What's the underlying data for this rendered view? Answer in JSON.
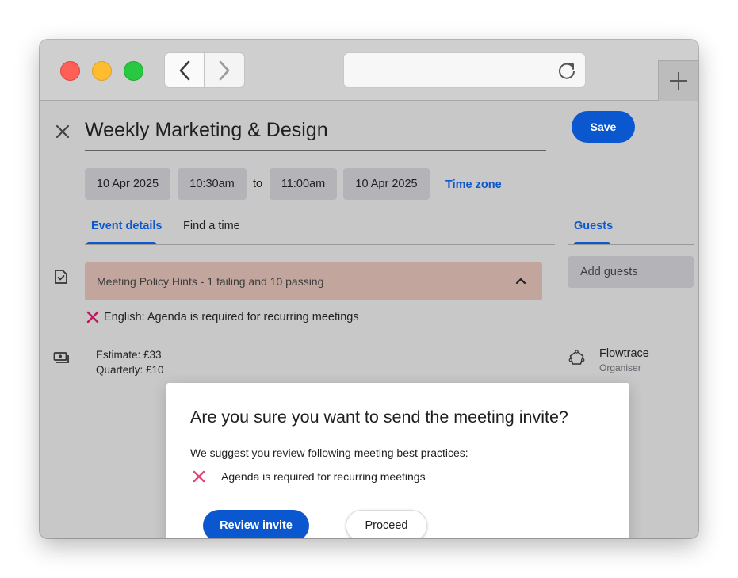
{
  "browser": {
    "back_icon": "chevron-left-icon",
    "forward_icon": "chevron-right-icon",
    "reload_icon": "reload-icon",
    "new_tab_icon": "plus-icon",
    "url": ""
  },
  "event": {
    "title": "Weekly Marketing & Design",
    "save_label": "Save",
    "start_date": "10 Apr 2025",
    "start_time": "10:30am",
    "to_label": "to",
    "end_time": "11:00am",
    "end_date": "10 Apr 2025",
    "time_zone_label": "Time zone"
  },
  "tabs": [
    {
      "label": "Event details",
      "active": true
    },
    {
      "label": "Find a time",
      "active": false
    }
  ],
  "policy": {
    "banner_text": "Meeting Policy Hints -  1 failing and 10 passing",
    "failing_item": "English: Agenda is required for recurring meetings"
  },
  "cost": {
    "estimate": "Estimate: £33",
    "quarterly": "Quarterly: £10"
  },
  "guests": {
    "tab_label": "Guests",
    "add_placeholder": "Add guests",
    "organiser_name": "Flowtrace",
    "organiser_role": "Organiser"
  },
  "dialog": {
    "title": "Are you sure you want to send the meeting invite?",
    "subtitle": "We suggest you review following meeting best practices:",
    "item": "Agenda is required for recurring meetings",
    "review_label": "Review invite",
    "proceed_label": "Proceed"
  },
  "colors": {
    "accent": "#0b57d0",
    "fail": "#d81b60",
    "banner": "#c2a69e"
  }
}
